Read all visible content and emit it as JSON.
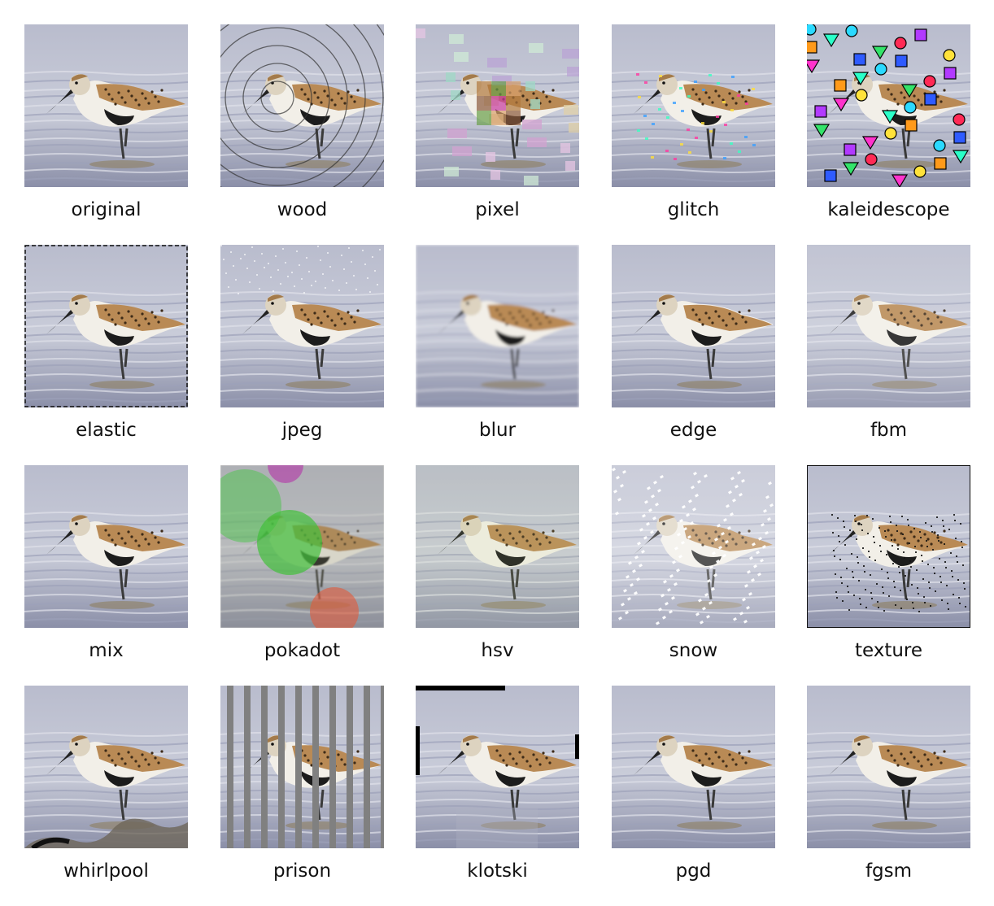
{
  "panels": [
    {
      "label": "original",
      "effect": "none"
    },
    {
      "label": "wood",
      "effect": "wood"
    },
    {
      "label": "pixel",
      "effect": "pixel"
    },
    {
      "label": "glitch",
      "effect": "glitch"
    },
    {
      "label": "kaleidescope",
      "effect": "kaleidescope"
    },
    {
      "label": "elastic",
      "effect": "elastic"
    },
    {
      "label": "jpeg",
      "effect": "jpeg"
    },
    {
      "label": "blur",
      "effect": "blur"
    },
    {
      "label": "edge",
      "effect": "edge"
    },
    {
      "label": "fbm",
      "effect": "fbm"
    },
    {
      "label": "mix",
      "effect": "mix"
    },
    {
      "label": "pokadot",
      "effect": "pokadot"
    },
    {
      "label": "hsv",
      "effect": "hsv"
    },
    {
      "label": "snow",
      "effect": "snow"
    },
    {
      "label": "texture",
      "effect": "texture"
    },
    {
      "label": "whirlpool",
      "effect": "whirlpool"
    },
    {
      "label": "prison",
      "effect": "prison"
    },
    {
      "label": "klotski",
      "effect": "klotski"
    },
    {
      "label": "pgd",
      "effect": "none"
    },
    {
      "label": "fgsm",
      "effect": "none"
    }
  ],
  "colors": {
    "water_light": "#c9ccd9",
    "water_dark": "#8b8fa8",
    "bird_back": "#b98a55",
    "bird_belly": "#f2efe8",
    "bird_patch": "#1c1c1c",
    "legs": "#3a3a3a"
  }
}
